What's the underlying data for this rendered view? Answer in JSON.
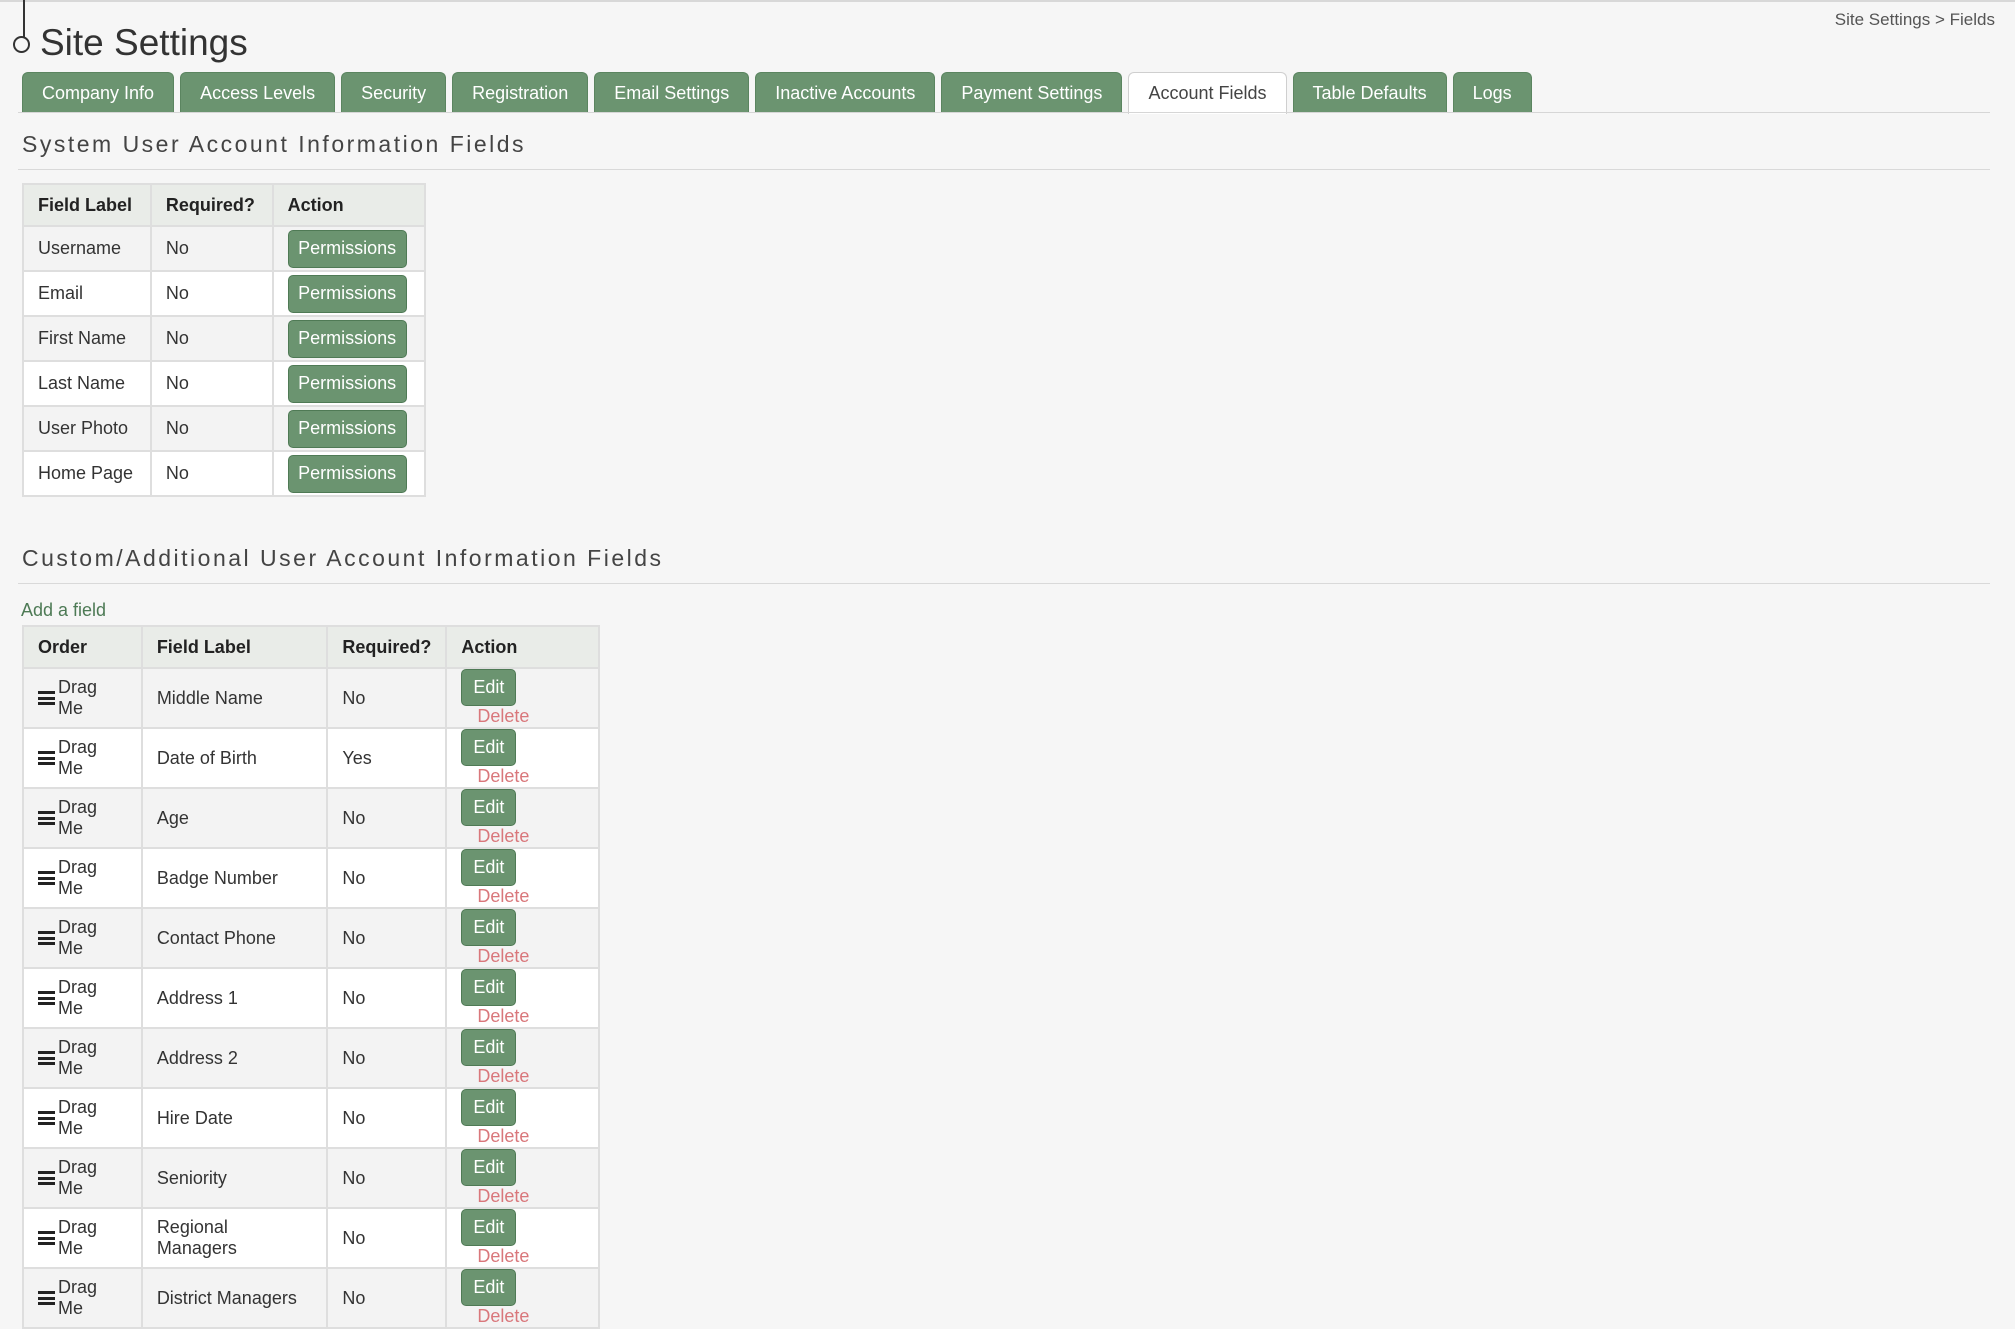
{
  "page": {
    "title": "Site Settings",
    "breadcrumb": {
      "root": "Site Settings",
      "separator": ">",
      "current": "Fields"
    }
  },
  "tabs": [
    {
      "label": "Company Info",
      "active": false
    },
    {
      "label": "Access Levels",
      "active": false
    },
    {
      "label": "Security",
      "active": false
    },
    {
      "label": "Registration",
      "active": false
    },
    {
      "label": "Email Settings",
      "active": false
    },
    {
      "label": "Inactive Accounts",
      "active": false
    },
    {
      "label": "Payment Settings",
      "active": false
    },
    {
      "label": "Account Fields",
      "active": true
    },
    {
      "label": "Table Defaults",
      "active": false
    },
    {
      "label": "Logs",
      "active": false
    }
  ],
  "system_fields": {
    "title": "System User Account Information Fields",
    "headers": {
      "label": "Field Label",
      "required": "Required?",
      "action": "Action"
    },
    "button_label": "Permissions",
    "rows": [
      {
        "label": "Username",
        "required": "No"
      },
      {
        "label": "Email",
        "required": "No"
      },
      {
        "label": "First Name",
        "required": "No"
      },
      {
        "label": "Last Name",
        "required": "No"
      },
      {
        "label": "User Photo",
        "required": "No"
      },
      {
        "label": "Home Page",
        "required": "No"
      }
    ]
  },
  "custom_fields": {
    "title": "Custom/Additional User Account Information Fields",
    "add_link": "Add a field",
    "headers": {
      "order": "Order",
      "label": "Field Label",
      "required": "Required?",
      "action": "Action"
    },
    "drag_label": "Drag Me",
    "edit_label": "Edit",
    "delete_label": "Delete",
    "rows": [
      {
        "label": "Middle Name",
        "required": "No"
      },
      {
        "label": "Date of Birth",
        "required": "Yes"
      },
      {
        "label": "Age",
        "required": "No"
      },
      {
        "label": "Badge Number",
        "required": "No"
      },
      {
        "label": "Contact Phone",
        "required": "No"
      },
      {
        "label": "Address 1",
        "required": "No"
      },
      {
        "label": "Address 2",
        "required": "No"
      },
      {
        "label": "Hire Date",
        "required": "No"
      },
      {
        "label": "Seniority",
        "required": "No"
      },
      {
        "label": "Regional Managers",
        "required": "No"
      },
      {
        "label": "District Managers",
        "required": "No"
      }
    ]
  },
  "colors": {
    "accent": "#6b9470",
    "delete": "#d9777b",
    "link": "#4d7a55",
    "background": "#f6f6f6"
  }
}
